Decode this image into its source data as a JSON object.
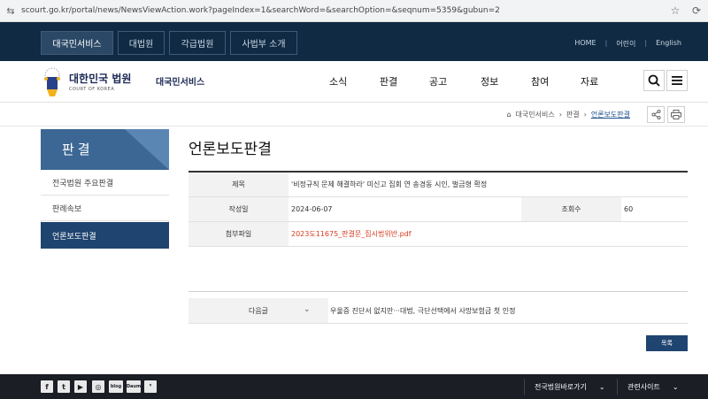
{
  "browser": {
    "url": "scourt.go.kr/portal/news/NewsViewAction.work?pageIndex=1&searchWord=&searchOption=&seqnum=5359&gubun=2"
  },
  "topnav": {
    "tabs": [
      "대국민서비스",
      "대법원",
      "각급법원",
      "사법부 소개"
    ],
    "links": [
      "HOME",
      "어린이",
      "English"
    ]
  },
  "header": {
    "brand_ko": "대한민국 법원",
    "brand_en": "COURT OF KOREA",
    "brand_sub": "대국민서비스",
    "menu": [
      "소식",
      "판결",
      "공고",
      "정보",
      "참여",
      "자료"
    ]
  },
  "breadcrumb": [
    "대국민서비스",
    "판결",
    "언론보도판결"
  ],
  "sidebar": {
    "title": "판결",
    "items": [
      "전국법원 주요판결",
      "판례속보",
      "언론보도판결"
    ],
    "active_index": 2
  },
  "page_title": "언론보도판결",
  "detail": {
    "title_label": "제목",
    "title_value": "'비정규직 문제 해결하라' 미신고 집회 연 송경동 시인, 벌금형 확정",
    "date_label": "작성일",
    "date_value": "2024-06-07",
    "views_label": "조회수",
    "views_value": "60",
    "file_label": "첨부파일",
    "file_value": "2023도11675_판결문_집시법위반.pdf"
  },
  "next": {
    "label": "다음글",
    "text": "우울증 진단서 없지만···대법, 극단선택에서 사망보험금 첫 인정"
  },
  "list_button": "목록",
  "footer": {
    "social": [
      "f",
      "t",
      "▶",
      "◎",
      "blog",
      "Daum",
      "❜"
    ],
    "select1": "전국법원바로가기",
    "select2": "관련사이트"
  },
  "colors": {
    "topbar": "#102a43",
    "sidebar_active": "#1f4470",
    "attachment": "#d83a1f"
  }
}
